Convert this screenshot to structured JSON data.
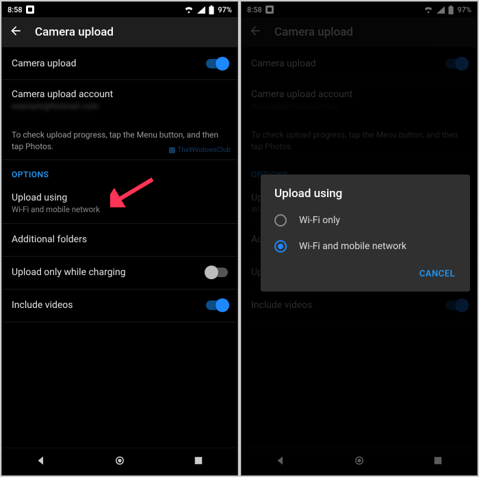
{
  "status": {
    "time": "8:58",
    "battery": "97%"
  },
  "appbar": {
    "title": "Camera upload"
  },
  "rows": {
    "camera_upload": "Camera upload",
    "account_title": "Camera upload account",
    "account_sub": "example@hotmail.com",
    "hint": "To check upload progress, tap the Menu button, and then tap Photos.",
    "watermark": "TheWindowsClub",
    "options_header": "OPTIONS",
    "upload_using_title": "Upload using",
    "upload_using_sub": "Wi-Fi and mobile network",
    "additional_folders": "Additional folders",
    "charging": "Upload only while charging",
    "include_videos": "Include videos"
  },
  "toggles": {
    "camera_upload": true,
    "charging": false,
    "include_videos": true
  },
  "dialog": {
    "title": "Upload using",
    "opt_wifi": "Wi-Fi only",
    "opt_both": "Wi-Fi and mobile network",
    "cancel": "CANCEL",
    "selected": "both"
  },
  "colors": {
    "accent": "#2196f3"
  }
}
